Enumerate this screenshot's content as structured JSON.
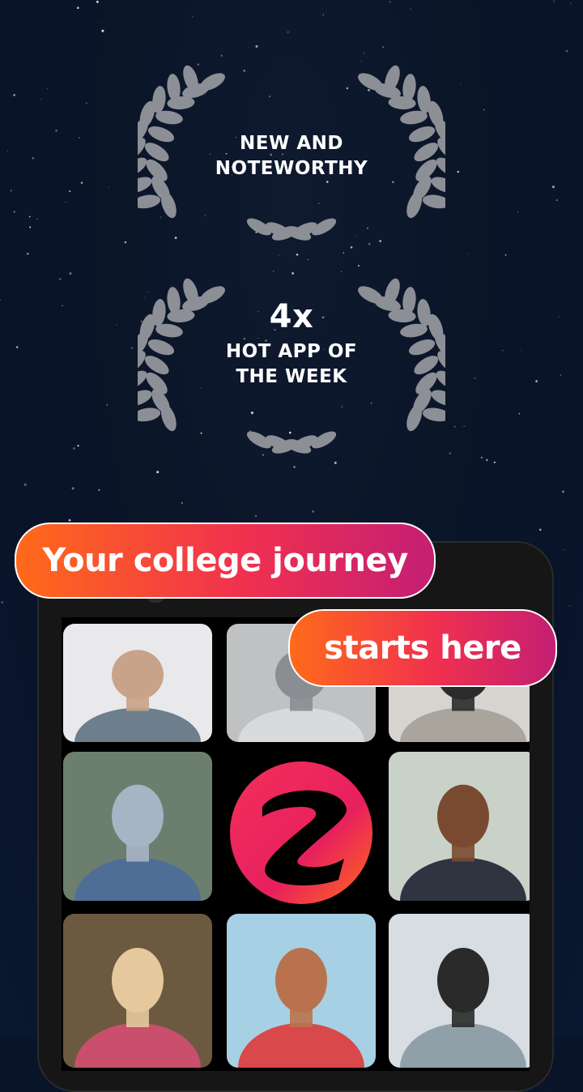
{
  "awards": [
    {
      "lines": [
        "NEW AND",
        "NOTEWORTHY"
      ]
    },
    {
      "multiplier": "4x",
      "lines": [
        "HOT APP OF",
        "THE WEEK"
      ]
    }
  ],
  "headline": {
    "line1": "Your college journey",
    "line2": "starts here"
  },
  "grid": {
    "tiles": [
      {
        "name": "photo-young-man-confetti"
      },
      {
        "name": "photo-person-sitting"
      },
      {
        "name": "photo-person-with-bag"
      },
      {
        "name": "photo-woman-with-hat"
      },
      {
        "name": "app-logo"
      },
      {
        "name": "photo-man-glasses-smiling"
      },
      {
        "name": "photo-girl-rainbow-hair"
      },
      {
        "name": "photo-boy-beach"
      },
      {
        "name": "photo-girl-net"
      }
    ]
  },
  "colors": {
    "accent_start": "#ff6a1a",
    "accent_end": "#c41f74",
    "background": "#0b1528",
    "laurel": "#8c8f96"
  },
  "icons": [
    "laurel-wreath-icon",
    "app-logo-icon"
  ]
}
